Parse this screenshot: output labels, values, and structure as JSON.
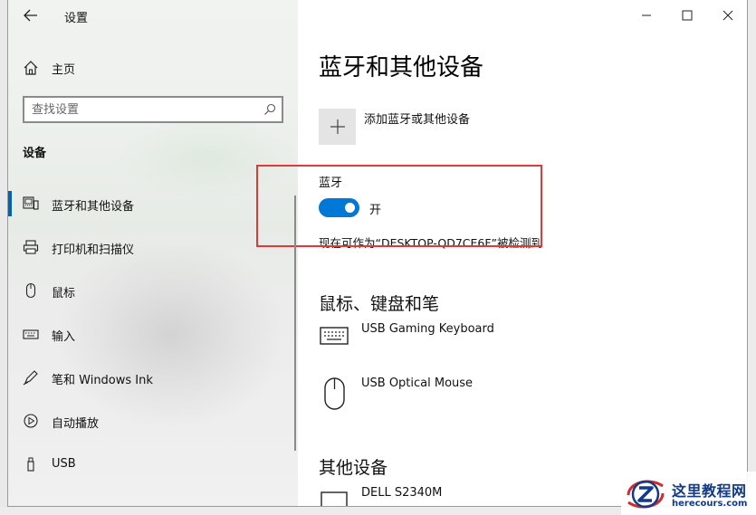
{
  "window": {
    "title": "设置",
    "controls": {
      "minimize": "minimize",
      "maximize": "maximize",
      "close": "close"
    }
  },
  "sidebar": {
    "home_label": "主页",
    "search_placeholder": "查找设置",
    "section_title": "设备",
    "items": [
      {
        "label": "蓝牙和其他设备",
        "icon": "bluetooth-devices-icon",
        "active": true
      },
      {
        "label": "打印机和扫描仪",
        "icon": "printer-icon",
        "active": false
      },
      {
        "label": "鼠标",
        "icon": "mouse-icon",
        "active": false
      },
      {
        "label": "输入",
        "icon": "keyboard-icon",
        "active": false
      },
      {
        "label": "笔和 Windows Ink",
        "icon": "pen-icon",
        "active": false
      },
      {
        "label": "自动播放",
        "icon": "autoplay-icon",
        "active": false
      },
      {
        "label": "USB",
        "icon": "usb-icon",
        "active": false
      }
    ]
  },
  "main": {
    "page_title": "蓝牙和其他设备",
    "add_device_label": "添加蓝牙或其他设备",
    "bluetooth": {
      "label": "蓝牙",
      "toggle_on": true,
      "state_text": "开",
      "discoverable_text": "现在可作为“DESKTOP-QD7CE6F”被检测到"
    },
    "mouse_keyboard_pen": {
      "title": "鼠标、键盘和笔",
      "devices": [
        {
          "name": "USB Gaming Keyboard",
          "icon": "keyboard-device-icon"
        },
        {
          "name": "USB Optical Mouse",
          "icon": "mouse-device-icon"
        }
      ]
    },
    "other_devices": {
      "title": "其他设备",
      "devices": [
        {
          "name": "DELL S2340M",
          "icon": "monitor-device-icon"
        }
      ]
    }
  },
  "watermark": {
    "title": "这里教程网",
    "url": "herecours.com"
  },
  "colors": {
    "accent": "#0078d7",
    "highlight_box": "#e0393a",
    "watermark": "#123a8a"
  }
}
